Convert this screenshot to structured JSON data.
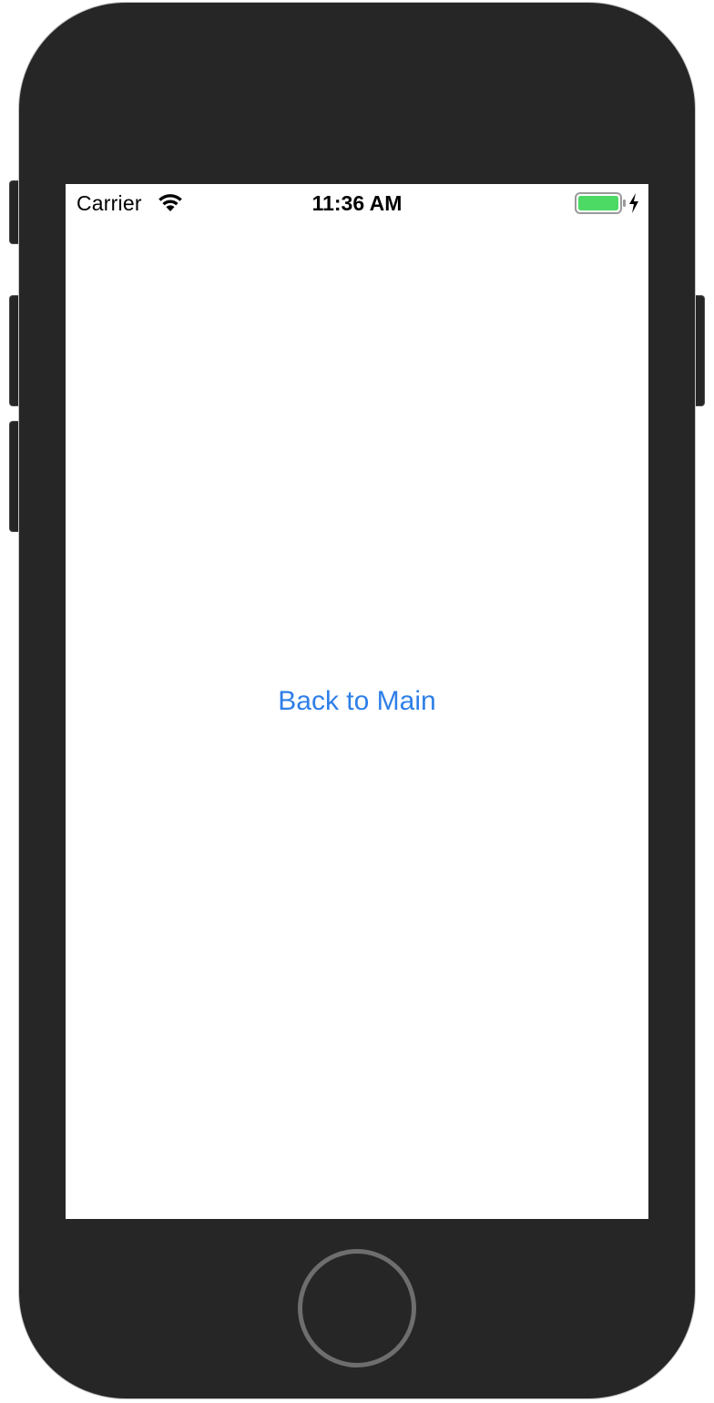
{
  "status_bar": {
    "carrier": "Carrier",
    "time": "11:36 AM",
    "wifi_icon": "wifi-icon",
    "battery_icon": "battery-full-icon",
    "charging_icon": "bolt-icon",
    "battery_color": "#4cd964"
  },
  "main": {
    "back_button_label": "Back to Main",
    "accent_color": "#2f7fe8"
  },
  "device": {
    "frame_color": "#262626",
    "home_button_icon": "home-button"
  }
}
